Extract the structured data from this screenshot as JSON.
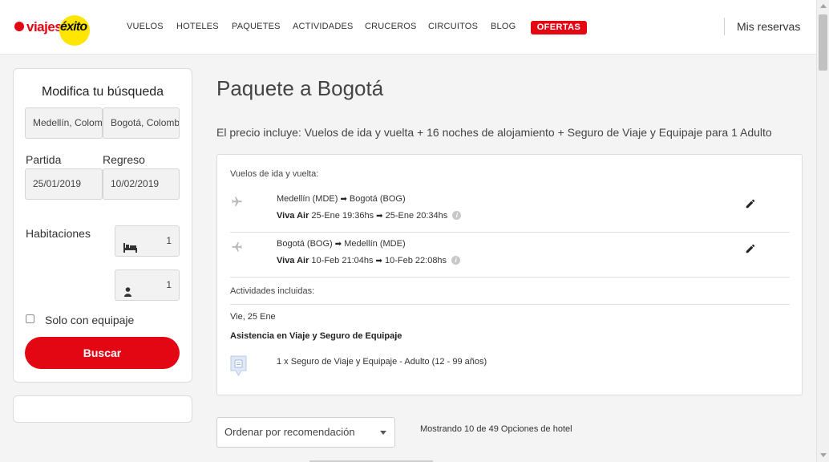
{
  "brand": {
    "name_part1": "viajes",
    "name_part2": "éxito"
  },
  "nav": {
    "items": [
      "VUELOS",
      "HOTELES",
      "PAQUETES",
      "ACTIVIDADES",
      "CRUCEROS",
      "CIRCUITOS",
      "BLOG"
    ],
    "offers": "OFERTAS",
    "reservations": "Mis reservas"
  },
  "colors": {
    "accent": "#e30613",
    "brand_yellow": "#ffe600"
  },
  "search": {
    "title": "Modifica tu búsqueda",
    "origin": "Medellín, Colombia",
    "destination": "Bogotá, Colombia",
    "departure_label": "Partida",
    "return_label": "Regreso",
    "departure_date": "25/01/2019",
    "return_date": "10/02/2019",
    "rooms_label": "Habitaciones",
    "rooms_value": "1",
    "adults_value": "1",
    "luggage_label": "Solo con equipaje",
    "search_button": "Buscar"
  },
  "main": {
    "title": "Paquete a Bogotá",
    "includes": "El precio incluye: Vuelos de ida y vuelta + 16 noches de alojamiento + Seguro de Viaje y Equipaje para 1 Adulto",
    "flights_label": "Vuelos de ida y vuelta:",
    "flights": [
      {
        "from": "Medellín (MDE)",
        "to": "Bogotá (BOG)",
        "airline": "Viva Air",
        "depart": "25-Ene 19:36hs",
        "arrive": "25-Ene 20:34hs"
      },
      {
        "from": "Bogotá (BOG)",
        "to": "Medellín (MDE)",
        "airline": "Viva Air",
        "depart": "10-Feb 21:04hs",
        "arrive": "10-Feb 22:08hs"
      }
    ],
    "activities_label": "Actividades incluidas:",
    "activity_date": "Vie, 25 Ene",
    "activity_name": "Asistencia en Viaje y Seguro de Equipaje",
    "activity_item": "1 x Seguro de Viaje y Equipaje - Adulto (12 - 99 años)",
    "sort_label": "Ordenar por recomendación",
    "showing": "Mostrando 10 de 49 Opciones de hotel"
  },
  "icons": {
    "plane": "plane-icon",
    "edit": "pencil-icon",
    "bed": "bed-icon",
    "person": "person-icon",
    "info": "info-icon",
    "insurance": "insurance-icon"
  }
}
